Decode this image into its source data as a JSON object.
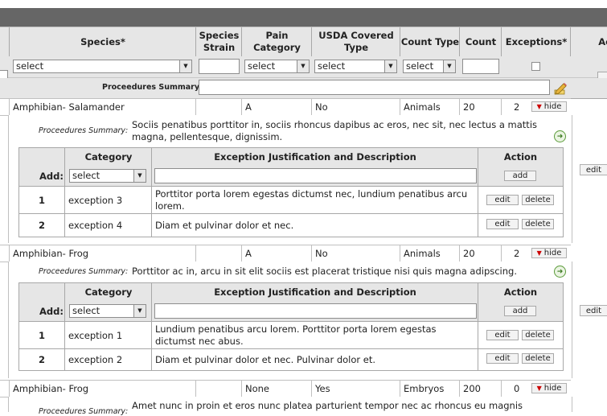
{
  "header": {
    "columns": {
      "species": "Species*",
      "species_strain": "Species Strain",
      "pain_category": "Pain Category",
      "usda_covered_type": "USDA Covered Type",
      "count_type": "Count Type",
      "count": "Count",
      "exceptions": "Exceptions*",
      "actions_partial": "Ac"
    }
  },
  "filters": {
    "species_select": "select",
    "pain_select": "select",
    "usda_select": "select",
    "count_type_select": "select",
    "procedures_summary_label": "Proceedures Summary:"
  },
  "records": [
    {
      "species": "Amphibian- Salamander",
      "strain": "",
      "pain": "A",
      "usda": "No",
      "count_type": "Animals",
      "count": "20",
      "exceptions": "2",
      "hide_label": "hide",
      "summary_label": "Proceedures Summary:",
      "summary": "Sociis penatibus porttitor in, sociis rhoncus dapibus ac eros, nec sit, nec lectus a mattis magna, pellentesque, dignissim.",
      "edit_label": "edit",
      "exc_table": {
        "h_category": "Category",
        "h_desc": "Exception Justification and Description",
        "h_action": "Action",
        "add_label": "Add:",
        "add_select": "select",
        "add_button": "add",
        "rows": [
          {
            "num": "1",
            "category": "exception 3",
            "desc": "Porttitor porta lorem egestas dictumst nec, lundium penatibus arcu lorem.",
            "edit": "edit",
            "delete": "delete"
          },
          {
            "num": "2",
            "category": "exception 4",
            "desc": "Diam et pulvinar dolor et nec.",
            "edit": "edit",
            "delete": "delete"
          }
        ]
      }
    },
    {
      "species": "Amphibian- Frog",
      "strain": "",
      "pain": "A",
      "usda": "No",
      "count_type": "Animals",
      "count": "20",
      "exceptions": "2",
      "hide_label": "hide",
      "summary_label": "Proceedures Summary:",
      "summary": "Porttitor ac in, arcu in sit elit sociis est placerat tristique nisi quis magna adipscing.",
      "edit_label": "edit",
      "exc_table": {
        "h_category": "Category",
        "h_desc": "Exception Justification and Description",
        "h_action": "Action",
        "add_label": "Add:",
        "add_select": "select",
        "add_button": "add",
        "rows": [
          {
            "num": "1",
            "category": "exception 1",
            "desc": "Lundium penatibus arcu lorem. Porttitor porta lorem egestas dictumst nec abus.",
            "edit": "edit",
            "delete": "delete"
          },
          {
            "num": "2",
            "category": "exception 2",
            "desc": "Diam et pulvinar dolor et nec. Pulvinar dolor et.",
            "edit": "edit",
            "delete": "delete"
          }
        ]
      }
    },
    {
      "species": "Amphibian- Frog",
      "strain": "",
      "pain": "None",
      "usda": "Yes",
      "count_type": "Embryos",
      "count": "200",
      "exceptions": "0",
      "hide_label": "hide",
      "summary_label": "Proceedures Summary:",
      "summary": "Amet nunc in proin et eros nunc platea parturient tempor nec ac rhoncus eu magnis"
    }
  ],
  "icons": {
    "pencil": "pencil-icon",
    "go": "go-arrow-icon",
    "dropdown": "chevron-down-icon"
  },
  "colors": {
    "header_bg": "#e6e6e6",
    "topbar": "#666666",
    "hide_arrow": "#cc0000"
  }
}
